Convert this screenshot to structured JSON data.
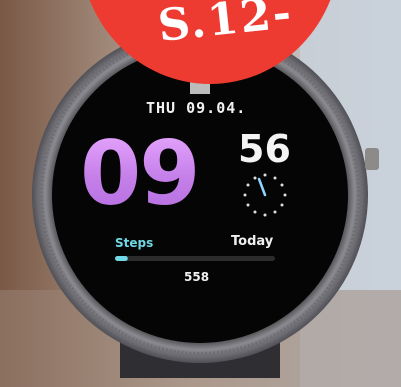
{
  "watch": {
    "date": "THU 09.04.",
    "hours": "09",
    "minutes": "56",
    "steps_label": "Steps",
    "today_label": "Today",
    "steps_value": "558",
    "steps_progress": 0.08
  },
  "badge": {
    "text": "S.12-"
  },
  "colors": {
    "background": "#e2a84a",
    "badge": "#ee3b32",
    "hours_gradient_top": "#e7a6ff",
    "hours_gradient_bottom": "#b46ee0",
    "steps_accent": "#6fd9e6"
  }
}
